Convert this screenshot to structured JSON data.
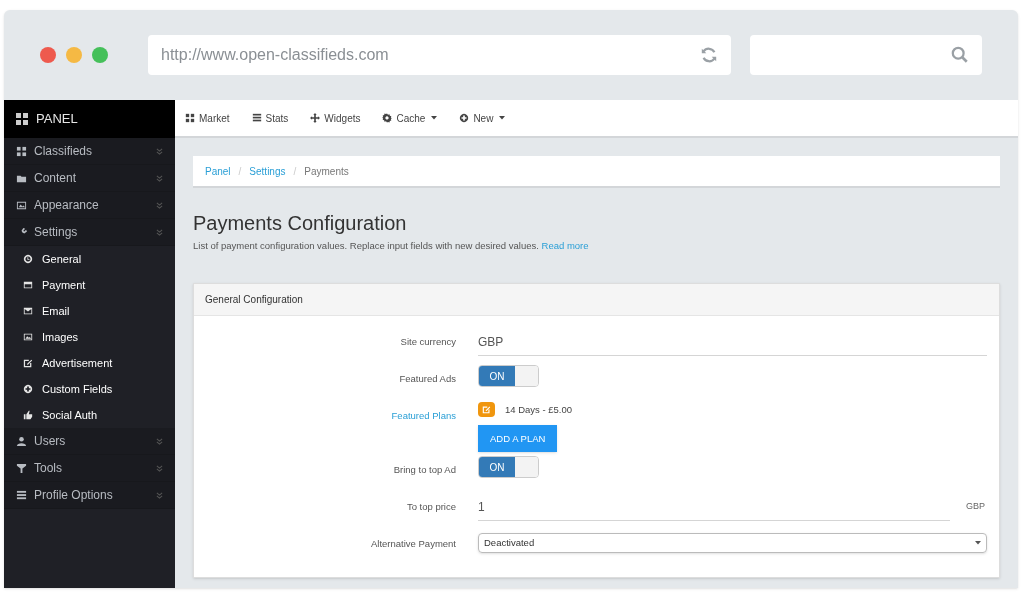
{
  "browser": {
    "url": "http://www.open-classifieds.com"
  },
  "sidebar": {
    "title": "PANEL",
    "items": [
      {
        "label": "Classifieds"
      },
      {
        "label": "Content"
      },
      {
        "label": "Appearance"
      },
      {
        "label": "Settings",
        "children": [
          {
            "label": "General"
          },
          {
            "label": "Payment"
          },
          {
            "label": "Email"
          },
          {
            "label": "Images"
          },
          {
            "label": "Advertisement"
          },
          {
            "label": "Custom Fields"
          },
          {
            "label": "Social Auth"
          }
        ]
      },
      {
        "label": "Users"
      },
      {
        "label": "Tools"
      },
      {
        "label": "Profile Options"
      }
    ]
  },
  "topnav": [
    {
      "label": "Market",
      "dropdown": false
    },
    {
      "label": "Stats",
      "dropdown": false
    },
    {
      "label": "Widgets",
      "dropdown": false
    },
    {
      "label": "Cache",
      "dropdown": true
    },
    {
      "label": "New",
      "dropdown": true
    }
  ],
  "breadcrumb": [
    {
      "label": "Panel",
      "link": true
    },
    {
      "separator": "/",
      "label": "Settings",
      "link": true
    },
    {
      "separator": "/",
      "label": "Payments",
      "link": false
    }
  ],
  "page": {
    "title": "Payments Configuration",
    "description": "List of payment configuration values. Replace input fields with new desired values.",
    "link": "Read more"
  },
  "panel": {
    "title": "General Configuration",
    "rows": [
      {
        "kind": "text",
        "label": "Site currency",
        "label_link": false,
        "value": "GBP"
      },
      {
        "kind": "toggle",
        "label": "Featured Ads",
        "label_link": false,
        "on": true,
        "on_label": "ON"
      },
      {
        "kind": "plans",
        "label": "Featured Plans",
        "label_link": true,
        "plans": [
          "14 Days - £5.00"
        ],
        "button": "ADD A PLAN"
      },
      {
        "kind": "toggle",
        "label": "Bring to top Ad",
        "label_link": false,
        "on": true,
        "on_label": "ON"
      },
      {
        "kind": "text",
        "label": "To top price",
        "label_link": false,
        "value": "1",
        "suffix": "GBP"
      },
      {
        "kind": "select",
        "label": "Alternative Payment",
        "label_link": false,
        "value": "Deactivated"
      }
    ]
  }
}
